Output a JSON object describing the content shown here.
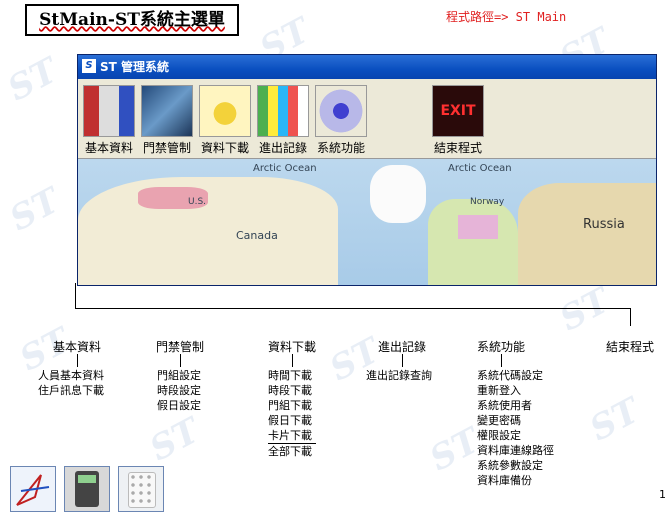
{
  "title": "StMain-ST系統主選單",
  "program_path": "程式路徑=> ST Main",
  "window": {
    "title": "ST 管理系統",
    "toolbar": [
      "基本資料",
      "門禁管制",
      "資料下載",
      "進出記錄",
      "系統功能",
      "結束程式"
    ],
    "map_labels": [
      "Arctic Ocean",
      "Arctic Ocean",
      "Canada",
      "Russia",
      "Norway",
      "U.S."
    ]
  },
  "menus": [
    {
      "label": "基本資料",
      "items": [
        "人員基本資料",
        "住戶訊息下載"
      ]
    },
    {
      "label": "門禁管制",
      "items": [
        "門組設定",
        "時段設定",
        "假日設定"
      ]
    },
    {
      "label": "資料下載",
      "items": [
        "時間下載",
        "時段下載",
        "門組下載",
        "假日下載",
        "卡片下載"
      ],
      "extra": "全部下載"
    },
    {
      "label": "進出記錄",
      "items": [
        "進出記錄查詢"
      ]
    },
    {
      "label": "系統功能",
      "items": [
        "系統代碼設定",
        "重新登入",
        "系統使用者",
        "變更密碼",
        "權限設定",
        "資料庫連線路徑",
        "系統參數設定",
        "資料庫備份"
      ]
    },
    {
      "label": "結束程式",
      "items": []
    }
  ],
  "page_number": "1"
}
